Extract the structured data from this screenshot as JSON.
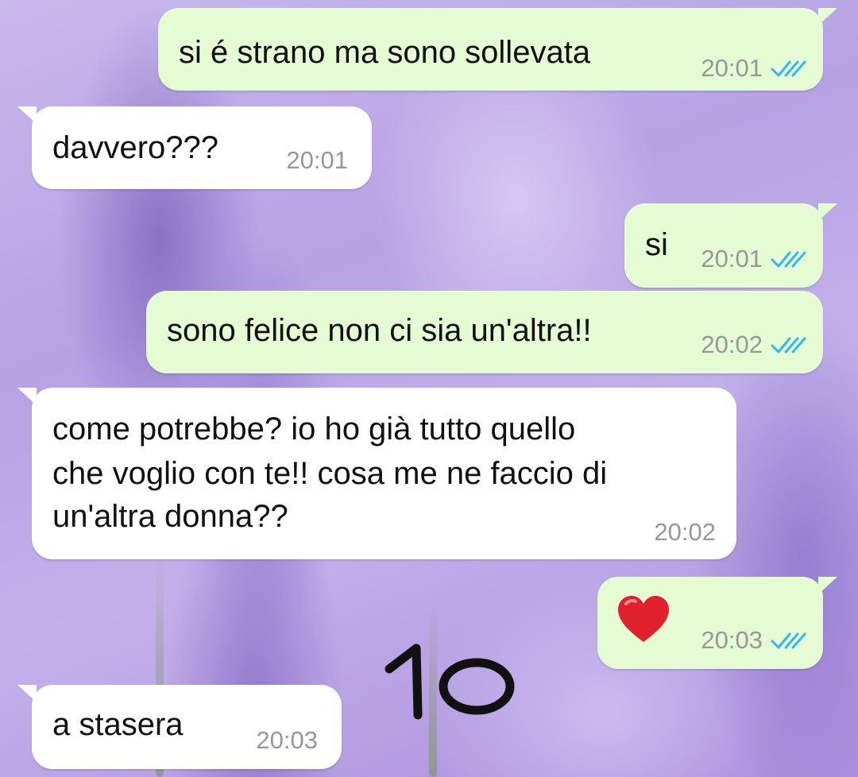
{
  "messages": [
    {
      "direction": "outgoing",
      "text": "si é strano ma sono sollevata",
      "time": "20:01",
      "status": "read"
    },
    {
      "direction": "incoming",
      "text": "davvero???",
      "time": "20:01"
    },
    {
      "direction": "outgoing",
      "text": "si",
      "time": "20:01",
      "status": "read"
    },
    {
      "direction": "outgoing",
      "text": "sono felice non ci sia un'altra!!",
      "time": "20:02",
      "status": "read"
    },
    {
      "direction": "incoming",
      "lines": [
        "come potrebbe? io ho già tutto quello",
        "che voglio con te!! cosa me ne faccio di",
        "un'altra donna??"
      ],
      "time": "20:02"
    },
    {
      "direction": "outgoing",
      "emoji": "red-heart",
      "time": "20:03",
      "status": "read"
    },
    {
      "direction": "incoming",
      "text": "a stasera",
      "time": "20:03"
    }
  ],
  "overlay": {
    "page_number": "10"
  },
  "colors": {
    "outgoing_bubble": "#e4fbd4",
    "incoming_bubble": "#ffffff",
    "read_ticks": "#34b7f1",
    "timestamp": "#979797",
    "heart": "#e0202c"
  },
  "background": {
    "image": "lavender-field-wallpaper"
  }
}
